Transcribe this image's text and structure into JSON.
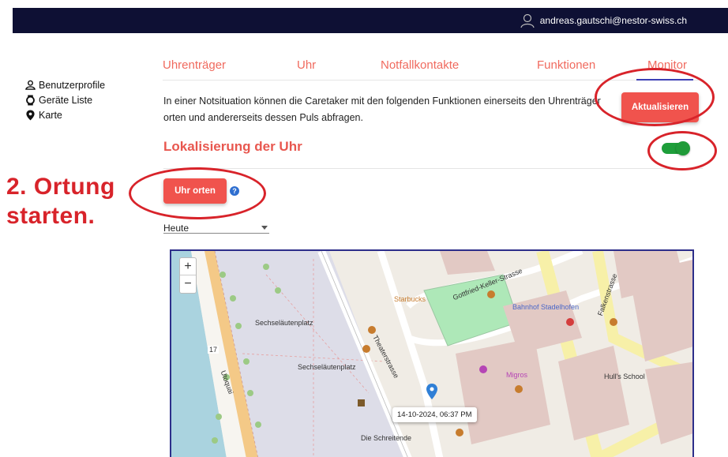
{
  "header": {
    "user_email": "andreas.gautschi@nestor-swiss.ch"
  },
  "sidebar": {
    "items": [
      {
        "label": "Benutzerprofile",
        "icon": "user-icon"
      },
      {
        "label": "Geräte Liste",
        "icon": "watch-icon"
      },
      {
        "label": "Karte",
        "icon": "map-pin-icon"
      }
    ]
  },
  "tabs": [
    {
      "label": "Uhrenträger"
    },
    {
      "label": "Uhr"
    },
    {
      "label": "Notfallkontakte"
    },
    {
      "label": "Funktionen"
    },
    {
      "label": "Monitor"
    }
  ],
  "active_tab": "Monitor",
  "main": {
    "description": "In einer Notsituation können die Caretaker mit den folgenden Funktionen einerseits den Uhrenträger orten und andererseits dessen Puls abfragen.",
    "refresh_label": "Aktualisieren",
    "section_title": "Lokalisierung der Uhr",
    "toggle_on": true,
    "locate_label": "Uhr orten",
    "help_icon": "?",
    "date_select": "Heute"
  },
  "annotation": {
    "line1": "2. Ortung",
    "line2": "starten."
  },
  "map": {
    "zoom_in": "+",
    "zoom_out": "−",
    "popup": "14-10-2024, 06:37 PM",
    "labels": {
      "place1": "Sechseläutenplatz",
      "place2": "Sechseläutenplatz",
      "station": "Bahnhof Stadelhofen",
      "street1": "Falkenstrasse",
      "street2": "Theaterstrasse",
      "street3": "Gottfried-Keller-Strasse",
      "school": "Hull's School",
      "statue": "Die Schreitende",
      "migros": "Migros",
      "starbucks": "Starbucks",
      "num17": "17",
      "utoquai": "Utoquai"
    }
  },
  "colors": {
    "topbar": "#0e1034",
    "accent": "#f0534d",
    "tab_text": "#f06a5e",
    "active_underline": "#3d3fb5",
    "toggle": "#1e9e3a",
    "annotation": "#d8232a"
  }
}
